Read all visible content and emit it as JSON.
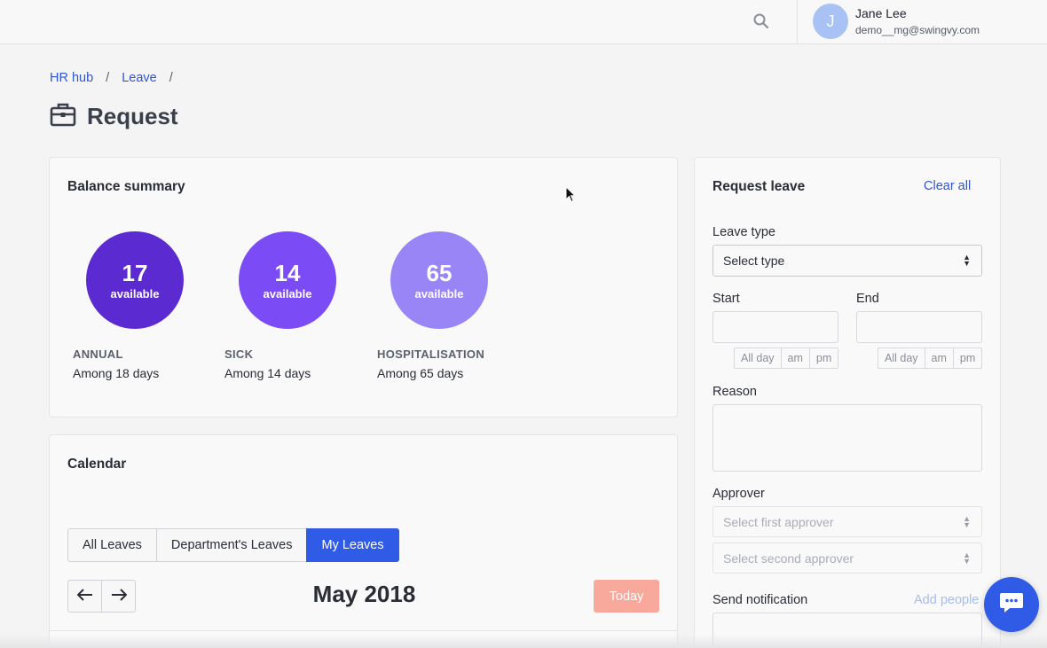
{
  "header": {
    "user": {
      "initial": "J",
      "name": "Jane Lee",
      "email": "demo__mg@swingvy.com"
    },
    "search_icon": "search-icon"
  },
  "breadcrumb": {
    "items": [
      "HR hub",
      "Leave"
    ],
    "separator": "/"
  },
  "page": {
    "title": "Request",
    "icon": "briefcase-icon"
  },
  "balance_summary": {
    "title": "Balance summary",
    "items": [
      {
        "count": "17",
        "unit": "available",
        "type": "ANNUAL",
        "among": "Among 18 days",
        "color": "#5b2ad0"
      },
      {
        "count": "14",
        "unit": "available",
        "type": "SICK",
        "among": "Among 14 days",
        "color": "#7b4cf6"
      },
      {
        "count": "65",
        "unit": "available",
        "type": "HOSPITALISATION",
        "among": "Among 65 days",
        "color": "#9a85f7"
      }
    ]
  },
  "calendar": {
    "title": "Calendar",
    "tabs": [
      "All Leaves",
      "Department's Leaves",
      "My Leaves"
    ],
    "active_tab": "My Leaves",
    "month": "May 2018",
    "today_label": "Today",
    "prev_icon": "arrow-left-icon",
    "next_icon": "arrow-right-icon"
  },
  "request_leave": {
    "title": "Request leave",
    "clear_all": "Clear all",
    "leave_type": {
      "label": "Leave type",
      "value": "Select type"
    },
    "start": {
      "label": "Start",
      "options": [
        "All day",
        "am",
        "pm"
      ]
    },
    "end": {
      "label": "End",
      "options": [
        "All day",
        "am",
        "pm"
      ]
    },
    "reason": {
      "label": "Reason"
    },
    "approver": {
      "label": "Approver",
      "first_placeholder": "Select first approver",
      "second_placeholder": "Select second approver"
    },
    "notification": {
      "label": "Send notification",
      "add_people": "Add people"
    }
  },
  "colors": {
    "accent": "#2f5be6",
    "link": "#2e56d6",
    "today_button": "#f8a99c"
  }
}
